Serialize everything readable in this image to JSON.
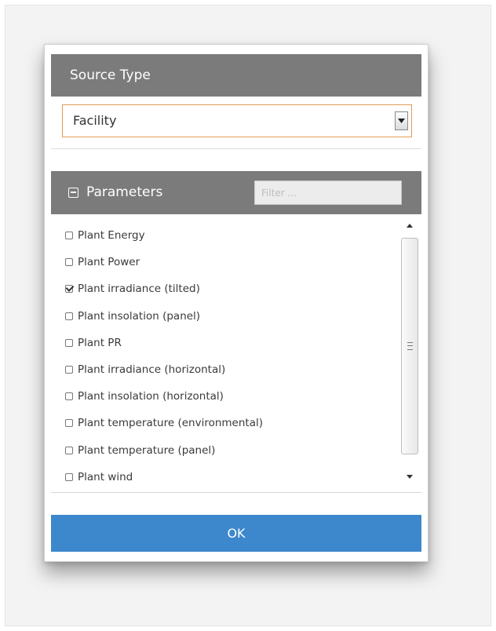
{
  "source_type": {
    "title": "Source Type",
    "selected_value": "Facility"
  },
  "parameters": {
    "title": "Parameters",
    "filter_placeholder": "Filter ...",
    "items": [
      {
        "label": "Plant Energy",
        "checked": false
      },
      {
        "label": "Plant Power",
        "checked": false
      },
      {
        "label": "Plant irradiance (tilted)",
        "checked": true
      },
      {
        "label": "Plant insolation (panel)",
        "checked": false
      },
      {
        "label": "Plant PR",
        "checked": false
      },
      {
        "label": "Plant irradiance (horizontal)",
        "checked": false
      },
      {
        "label": "Plant insolation (horizontal)",
        "checked": false
      },
      {
        "label": "Plant temperature (environmental)",
        "checked": false
      },
      {
        "label": "Plant temperature (panel)",
        "checked": false
      },
      {
        "label": "Plant wind",
        "checked": false
      }
    ]
  },
  "ok_button": {
    "label": "OK"
  },
  "colors": {
    "header": "#7b7b7b",
    "accent_blue": "#3d87cc",
    "select_border": "#e39a55"
  }
}
